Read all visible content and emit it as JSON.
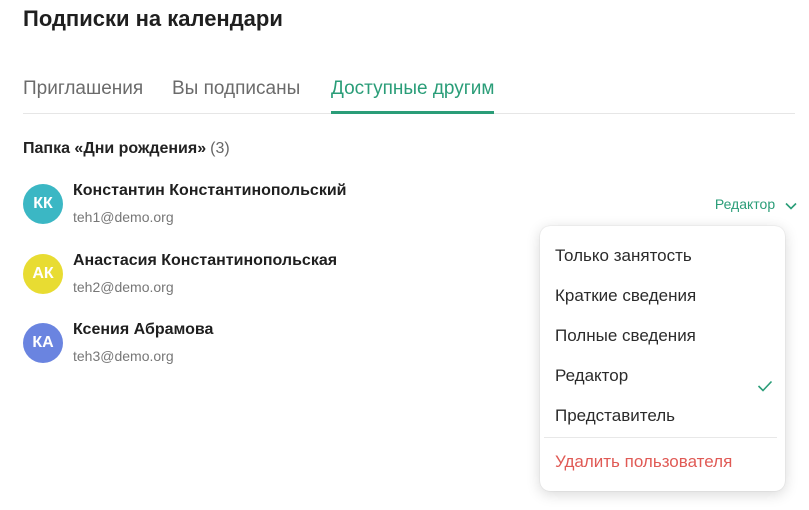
{
  "page": {
    "title": "Подписки на календари"
  },
  "tabs": [
    {
      "label": "Приглашения"
    },
    {
      "label": "Вы подписаны"
    },
    {
      "label": "Доступные другим"
    }
  ],
  "folder": {
    "label": "Папка «Дни рождения»",
    "count": "(3)"
  },
  "users": [
    {
      "initials": "КК",
      "name": "Константин Константинопольский",
      "email": "teh1@demo.org",
      "avatar_color": "#3bb7c4"
    },
    {
      "initials": "АК",
      "name": "Анастасия Константинопольская",
      "email": "teh2@demo.org",
      "avatar_color": "#e8dc32"
    },
    {
      "initials": "КА",
      "name": "Ксения Абрамова",
      "email": "teh3@demo.org",
      "avatar_color": "#6a84e0"
    }
  ],
  "role_select": {
    "value": "Редактор"
  },
  "dropdown": {
    "items": [
      {
        "label": "Только занятость"
      },
      {
        "label": "Краткие сведения"
      },
      {
        "label": "Полные сведения"
      },
      {
        "label": "Редактор"
      },
      {
        "label": "Представитель"
      }
    ],
    "delete_label": "Удалить пользователя"
  },
  "colors": {
    "accent": "#2a9d78",
    "danger": "#e05a55"
  }
}
